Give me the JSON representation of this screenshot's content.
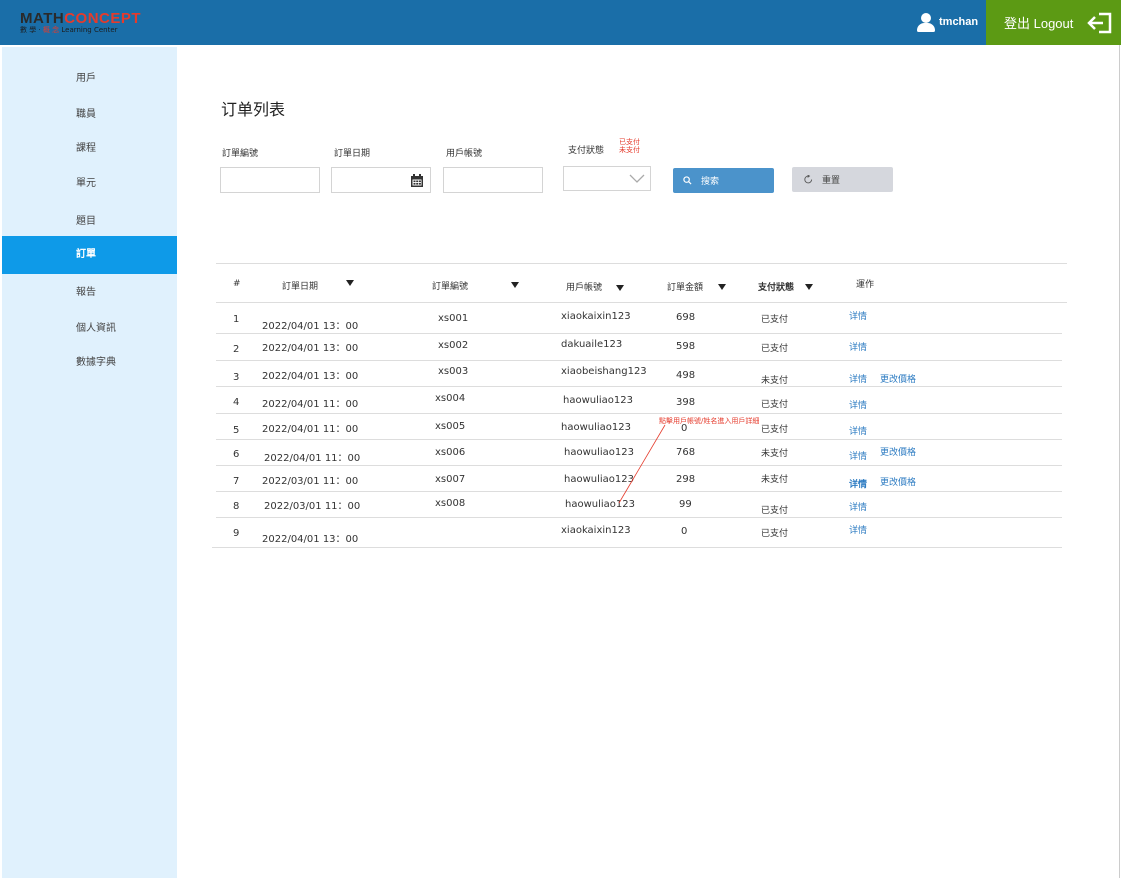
{
  "header": {
    "logo_main_a": "MATH",
    "logo_main_b": "CONCEPT",
    "logo_sub_a": "數 學 · ",
    "logo_sub_red": "概 念",
    "logo_sub_b": " Learning Center",
    "username": "tmchan",
    "logout_label": "登出 Logout"
  },
  "sidebar": {
    "items": [
      {
        "label": "用戶"
      },
      {
        "label": "職員"
      },
      {
        "label": "課程"
      },
      {
        "label": "單元"
      },
      {
        "label": "題目"
      },
      {
        "label": "訂單"
      },
      {
        "label": "報告"
      },
      {
        "label": "個人資訊"
      },
      {
        "label": "數據字典"
      }
    ],
    "active_index": 5
  },
  "main": {
    "title": "订单列表",
    "filters": {
      "order_no_label": "訂單編號",
      "order_date_label": "訂單日期",
      "user_account_label": "用戶帳號",
      "pay_status_label": "支付狀態",
      "pay_status_options": [
        "已支付",
        "未支付"
      ],
      "search_label": "搜索",
      "reset_label": "重置"
    },
    "annotation": "點擊用戶帳號/姓名進入用戶詳細"
  },
  "table": {
    "headers": [
      "#",
      "訂單日期",
      "訂單編號",
      "用戶帳號",
      "訂單金額",
      "支付狀態",
      "運作"
    ],
    "rows": [
      {
        "no": "1",
        "date": "2022/04/01 13：00",
        "order": "xs001",
        "user": "xiaokaixin123",
        "amount": "698",
        "status": "已支付",
        "detail": "详情",
        "change": ""
      },
      {
        "no": "2",
        "date": "2022/04/01 13：00",
        "order": "xs002",
        "user": "dakuaile123",
        "amount": "598",
        "status": "已支付",
        "detail": "详情",
        "change": ""
      },
      {
        "no": "3",
        "date": "2022/04/01 13：00",
        "order": "xs003",
        "user": "xiaobeishang123",
        "amount": "498",
        "status": "未支付",
        "detail": "详情",
        "change": "更改價格"
      },
      {
        "no": "4",
        "date": "2022/04/01 11：00",
        "order": "xs004",
        "user": "haowuliao123",
        "amount": "398",
        "status": "已支付",
        "detail": "详情",
        "change": ""
      },
      {
        "no": "5",
        "date": "2022/04/01 11：00",
        "order": "xs005",
        "user": "haowuliao123",
        "amount": "0",
        "status": "已支付",
        "detail": "详情",
        "change": ""
      },
      {
        "no": "6",
        "date": "2022/04/01 11：00",
        "order": "xs006",
        "user": "haowuliao123",
        "amount": "768",
        "status": "未支付",
        "detail": "详情",
        "change": "更改價格"
      },
      {
        "no": "7",
        "date": "2022/03/01 11：00",
        "order": "xs007",
        "user": "haowuliao123",
        "amount": "298",
        "status": "未支付",
        "detail": "详情",
        "change": "更改價格"
      },
      {
        "no": "8",
        "date": "2022/03/01 11：00",
        "order": "xs008",
        "user": "haowuliao123",
        "amount": "99",
        "status": "已支付",
        "detail": "详情",
        "change": ""
      },
      {
        "no": "9",
        "date": "2022/04/01 13：00",
        "order": "",
        "user": "xiaokaixin123",
        "amount": "0",
        "status": "已支付",
        "detail": "详情",
        "change": ""
      }
    ]
  }
}
